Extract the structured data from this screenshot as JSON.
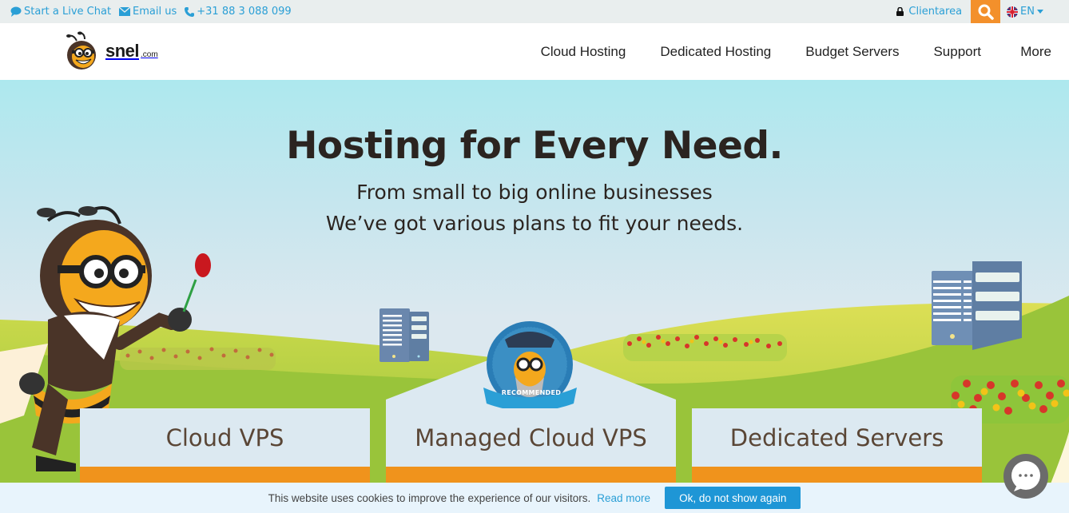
{
  "topbar": {
    "live_chat": "Start a Live Chat",
    "email": "Email us",
    "phone": "+31 88 3 088 099",
    "clientarea": "Clientarea",
    "language": "EN",
    "icons": {
      "chat": "chat-icon",
      "email": "envelope-icon",
      "phone": "phone-icon",
      "lock": "lock-icon",
      "search": "search-icon",
      "flag": "uk-flag-icon",
      "caret": "caret-down-icon"
    }
  },
  "header": {
    "logo_text": "snel",
    "logo_suffix": ".com",
    "nav": [
      {
        "label": "Cloud Hosting"
      },
      {
        "label": "Dedicated Hosting"
      },
      {
        "label": "Budget Servers"
      },
      {
        "label": "Support"
      },
      {
        "label": "More"
      }
    ]
  },
  "hero": {
    "title": "Hosting for Every Need.",
    "subtitle_line1": "From small to big online businesses",
    "subtitle_line2": "We’ve got various plans to fit your needs.",
    "badge": "RECOMMENDED"
  },
  "plans": [
    {
      "label": "Cloud VPS"
    },
    {
      "label": "Managed Cloud VPS"
    },
    {
      "label": "Dedicated Servers"
    }
  ],
  "cookie": {
    "message": "This website uses cookies to improve the experience of our visitors.",
    "read_more": "Read more",
    "ok_button": "Ok, do not show again"
  },
  "colors": {
    "accent_orange": "#f3902b",
    "link_blue": "#2a9fd6",
    "button_blue": "#1e96d6",
    "card_bar_orange": "#f0931c",
    "heading_dark": "#2b2420",
    "card_text_brown": "#5a4636"
  }
}
